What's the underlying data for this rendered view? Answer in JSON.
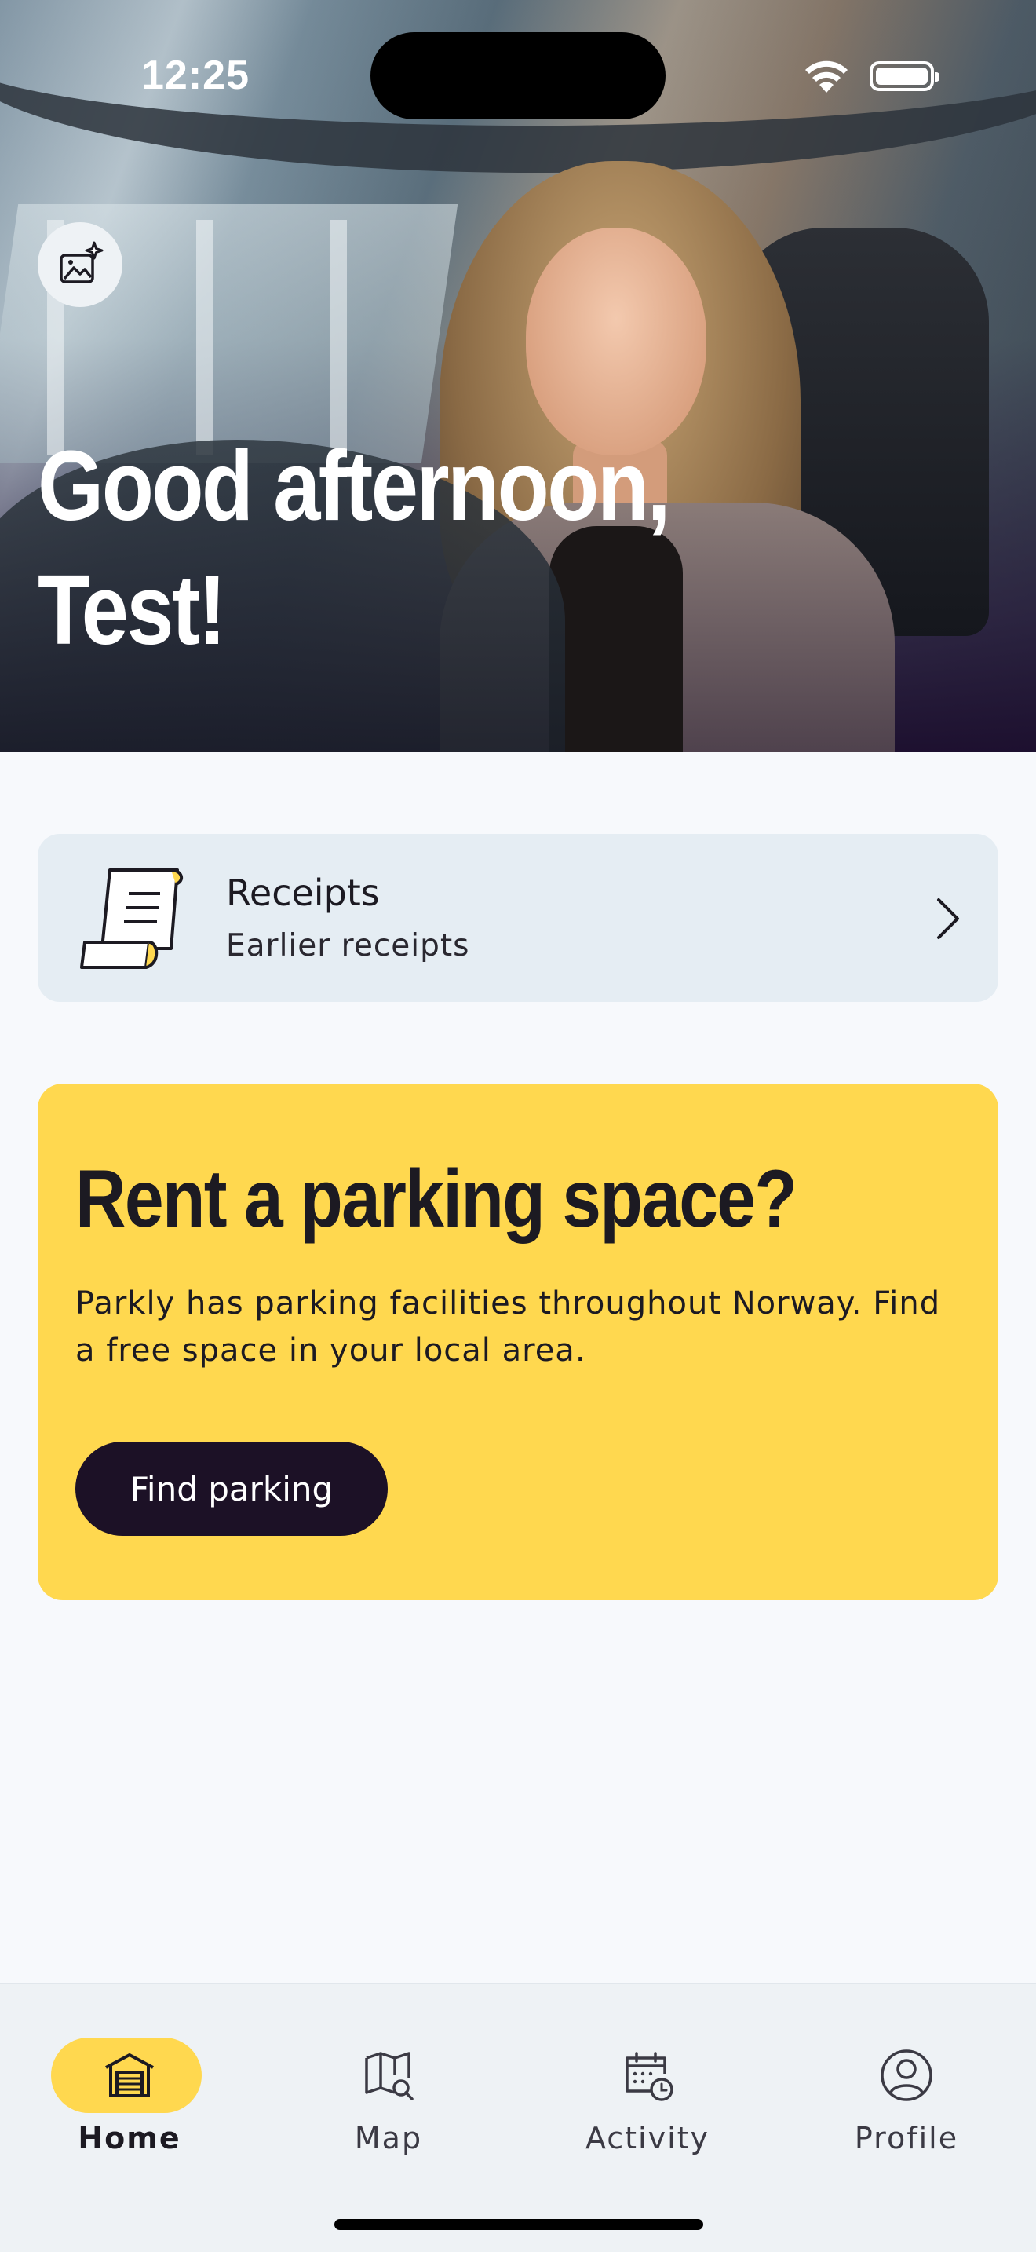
{
  "status_bar": {
    "time": "12:25"
  },
  "hero": {
    "greeting": "Good afternoon, Test!",
    "image_button_icon": "image-sparkle-icon"
  },
  "receipts": {
    "title": "Receipts",
    "subtitle": "Earlier receipts",
    "icon": "receipt-scroll-icon"
  },
  "promo": {
    "title": "Rent a parking space?",
    "text": "Parkly has parking facilities throughout Norway. Find a free space in your local area.",
    "button_label": "Find parking"
  },
  "tabs": [
    {
      "label": "Home",
      "icon": "garage-icon",
      "active": true
    },
    {
      "label": "Map",
      "icon": "map-search-icon",
      "active": false
    },
    {
      "label": "Activity",
      "icon": "calendar-clock-icon",
      "active": false
    },
    {
      "label": "Profile",
      "icon": "user-circle-icon",
      "active": false
    }
  ],
  "colors": {
    "accent_yellow": "#ffd84f",
    "dark_button": "#1c1126",
    "card_bg": "#e5edf3",
    "tabbar_bg": "#eef2f5"
  }
}
